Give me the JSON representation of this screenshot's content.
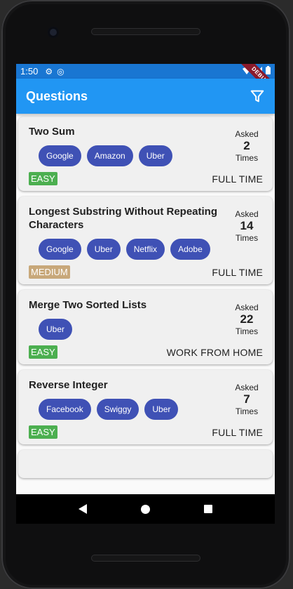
{
  "statusbar": {
    "time": "1:50",
    "debug_label": "DEBUG"
  },
  "appbar": {
    "title": "Questions",
    "filter_icon": "filter-icon"
  },
  "asked_label": "Asked",
  "times_label": "Times",
  "questions": [
    {
      "title": "Two Sum",
      "companies": [
        "Google",
        "Amazon",
        "Uber"
      ],
      "asked": "2",
      "difficulty": "EASY",
      "job_type": "FULL TIME"
    },
    {
      "title": "Longest Substring Without Repeating Characters",
      "companies": [
        "Google",
        "Uber",
        "Netflix",
        "Adobe"
      ],
      "asked": "14",
      "difficulty": "MEDIUM",
      "job_type": "FULL TIME"
    },
    {
      "title": "Merge Two Sorted Lists",
      "companies": [
        "Uber"
      ],
      "asked": "22",
      "difficulty": "EASY",
      "job_type": "WORK FROM HOME"
    },
    {
      "title": "Reverse Integer",
      "companies": [
        "Facebook",
        "Swiggy",
        "Uber"
      ],
      "asked": "7",
      "difficulty": "EASY",
      "job_type": "FULL TIME"
    }
  ],
  "colors": {
    "appbar": "#2196f3",
    "statusbar": "#1976d2",
    "chip": "#3f51b5",
    "easy": "#4caf50",
    "medium": "#c8a87a"
  }
}
